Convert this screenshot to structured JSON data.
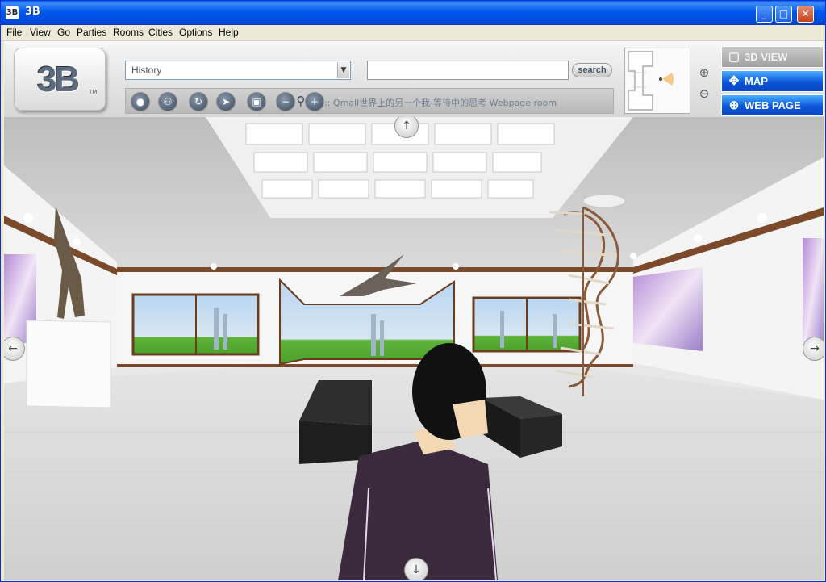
{
  "window": {
    "title": "3B",
    "app_icon_text": "3B"
  },
  "menu": [
    "File",
    "View",
    "Go",
    "Parties",
    "Rooms",
    "Cities",
    "Options",
    "Help"
  ],
  "logo": {
    "text": "3B",
    "tm": "TM"
  },
  "history": {
    "label": "History"
  },
  "search": {
    "value": "",
    "button_label": "search"
  },
  "status": {
    "text": ":: Qmall世界上的另一个我-等待中的思考 Webpage room"
  },
  "view_buttons": [
    {
      "label": "3D VIEW",
      "icon": "cube-icon",
      "state": "inactive"
    },
    {
      "label": "MAP",
      "icon": "compass-icon",
      "state": "active"
    },
    {
      "label": "WEB PAGE",
      "icon": "globe-icon",
      "state": "active"
    }
  ],
  "icons": [
    "chat-icon",
    "people-icon",
    "refresh-icon",
    "pointer-icon",
    "box-icon",
    "zoom-out-icon",
    "walk-icon",
    "zoom-in-icon"
  ],
  "colors": {
    "titlebar": "#0058ee",
    "view_active": "#0a55d8",
    "view_inactive": "#a1a1a1"
  }
}
